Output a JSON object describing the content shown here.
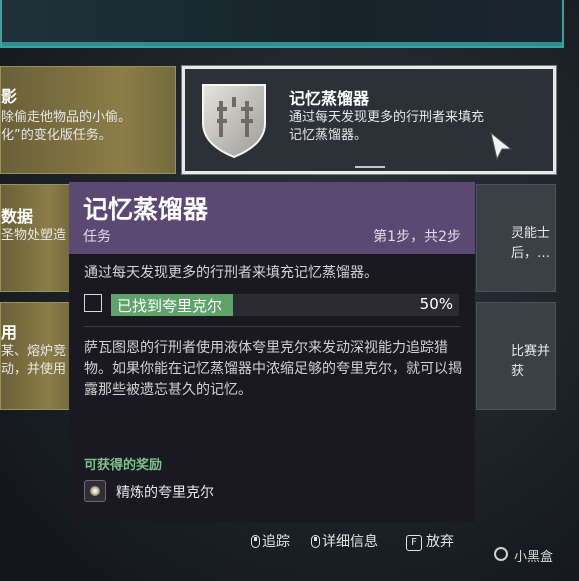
{
  "cards": {
    "top_left_1": {
      "title": "影",
      "lines": [
        "除偷走他物品的小偷。",
        "化”的变化版任务。"
      ]
    },
    "selected": {
      "title": "记忆蒸馏器",
      "lines": [
        "通过每天发现更多的行刑者来填充",
        "记忆蒸馏器。"
      ]
    },
    "left_2": {
      "title": "数据",
      "lines": [
        "圣物处塑造"
      ]
    },
    "right_2": {
      "lines": [
        "灵能士",
        "后，…"
      ]
    },
    "left_3": {
      "title": "用",
      "lines": [
        "某、熔炉竞",
        "动，并使用"
      ]
    },
    "right_3": {
      "lines": [
        "比赛并",
        "获"
      ]
    }
  },
  "popup": {
    "title": "记忆蒸馏器",
    "type": "任务",
    "step": "第1步，共2步",
    "description": "通过每天发现更多的行刑者来填充记忆蒸馏器。",
    "objective": {
      "label": "已找到夸里克尔",
      "percent_text": "50%",
      "progress": 0.5
    },
    "lore": "萨瓦图恩的行刑者使用液体夸里克尔来发动深视能力追踪猎物。如果你能在记忆蒸馏器中浓缩足够的夸里克尔，就可以揭露那些被遗忘甚久的记忆。",
    "rewards_heading": "可获得的奖励",
    "reward_name": "精炼的夸里克尔"
  },
  "hints": {
    "track": "追踪",
    "details": "详细信息",
    "abandon_key": "F",
    "abandon": "放弃"
  },
  "watermark": "小黑盒",
  "colors": {
    "accent_teal": "#3aa3a1",
    "popup_header": "#5b4873",
    "progress_green": "#5fa36b",
    "reward_heading": "#7ec08b"
  }
}
